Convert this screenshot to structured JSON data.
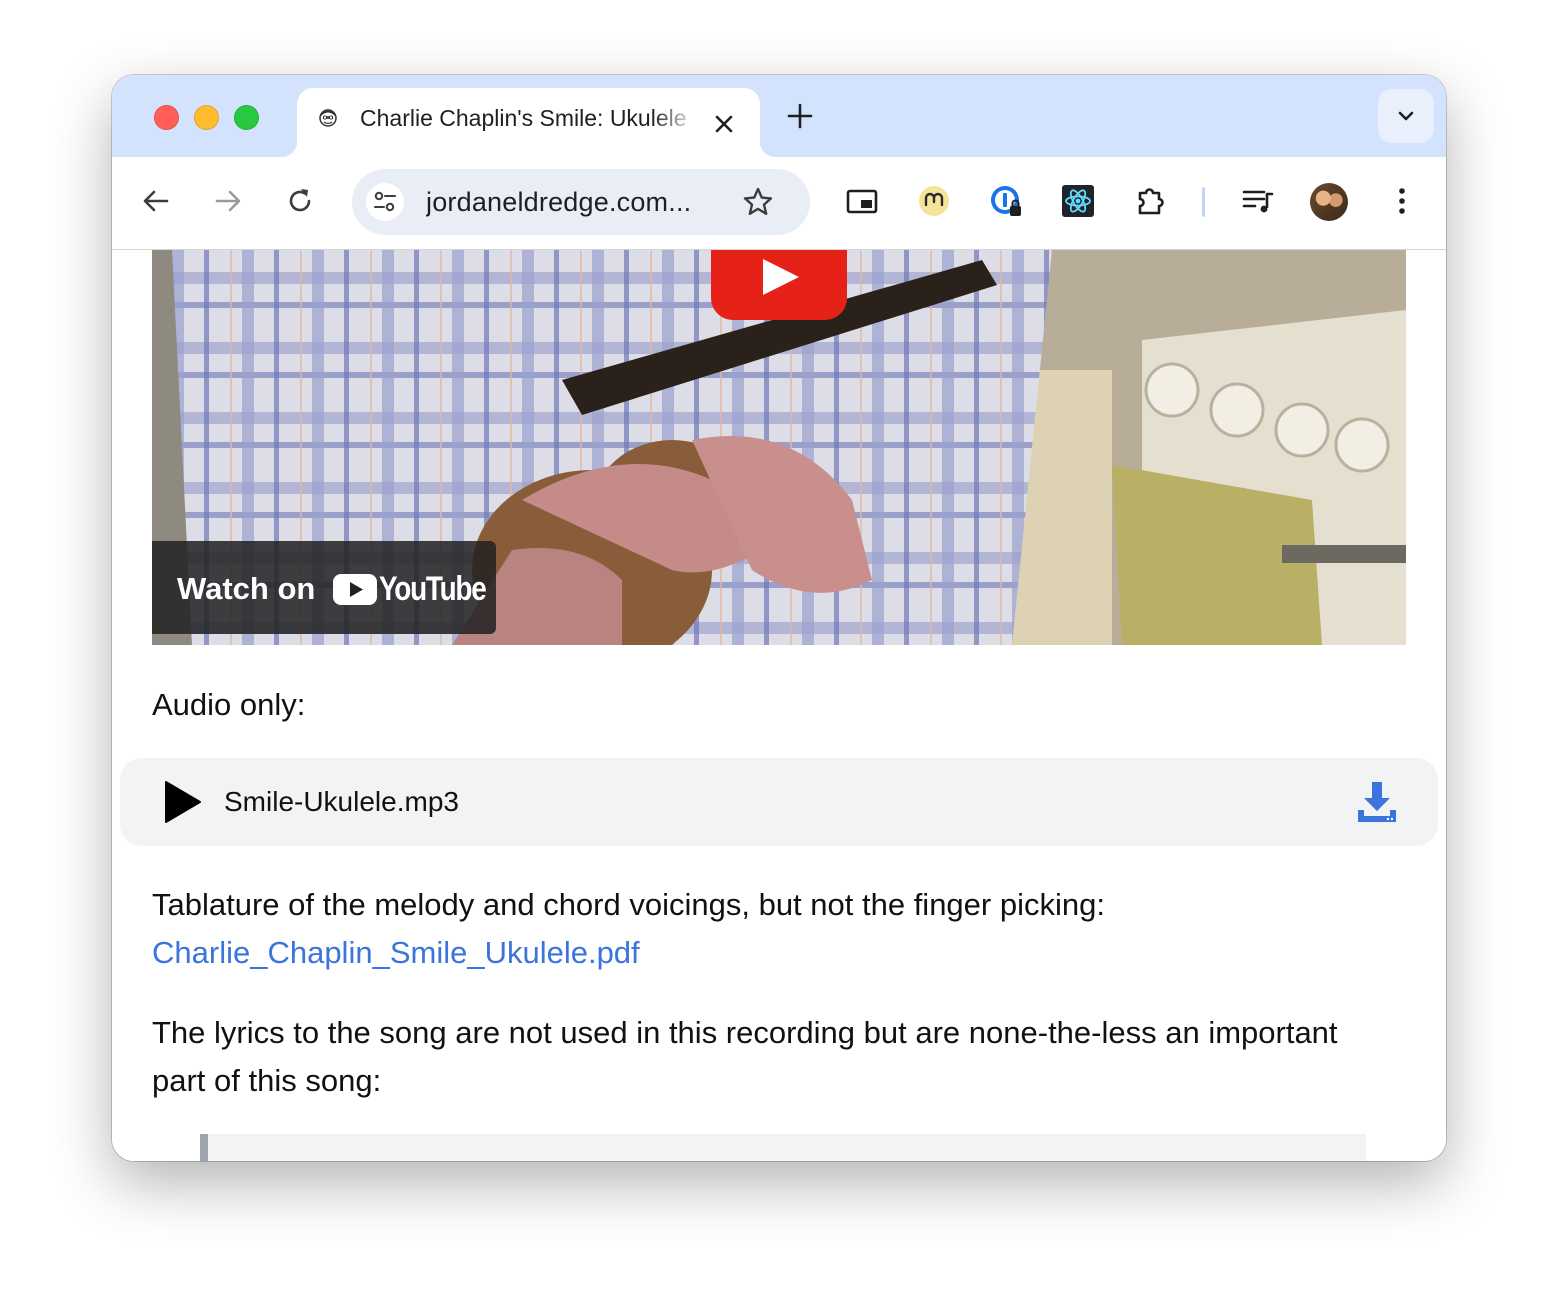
{
  "browser": {
    "tab": {
      "title": "Charlie Chaplin's Smile: Ukulele",
      "favicon": "avatar-favicon-icon"
    },
    "new_tab_icon": "plus-icon",
    "tab_search_icon": "chevron-down-icon",
    "toolbar": {
      "back_icon": "back-arrow-icon",
      "forward_icon": "forward-arrow-icon",
      "reload_icon": "reload-icon",
      "site_info_icon": "tune-icon",
      "url": "jordaneldredge.com/notes/charlie-chaplins-smile-ukulele/",
      "bookmark_icon": "star-icon",
      "extensions": [
        "picture-in-picture-icon",
        "mastodon-extension-icon",
        "password-manager-icon",
        "react-devtools-icon",
        "puzzle-extensions-icon"
      ],
      "media_icon": "queue-music-icon",
      "profile_icon": "profile-avatar",
      "menu_icon": "kebab-menu-icon"
    }
  },
  "page": {
    "video": {
      "watch_on_label": "Watch on",
      "youtube_wordmark": "YouTube",
      "play_icon": "play-icon"
    },
    "audio_heading": "Audio only:",
    "audio_player": {
      "file_name": "Smile-Ukulele.mp3",
      "play_icon": "play-icon",
      "download_icon": "download-icon",
      "accent": "#3b74dc"
    },
    "tablature_text": "Tablature of the melody and chord voicings, but not the finger picking:",
    "pdf_link": "Charlie_Chaplin_Smile_Ukulele.pdf",
    "lyrics_intro": "The lyrics to the song are not used in this recording but are none-the-less an important part of this song:"
  },
  "colors": {
    "tabstrip": "#d3e3fd",
    "omnibox": "#e9eef6",
    "link": "#3b74dc",
    "youtube_red": "#e62117",
    "audio_bg": "#f1f3f5"
  }
}
